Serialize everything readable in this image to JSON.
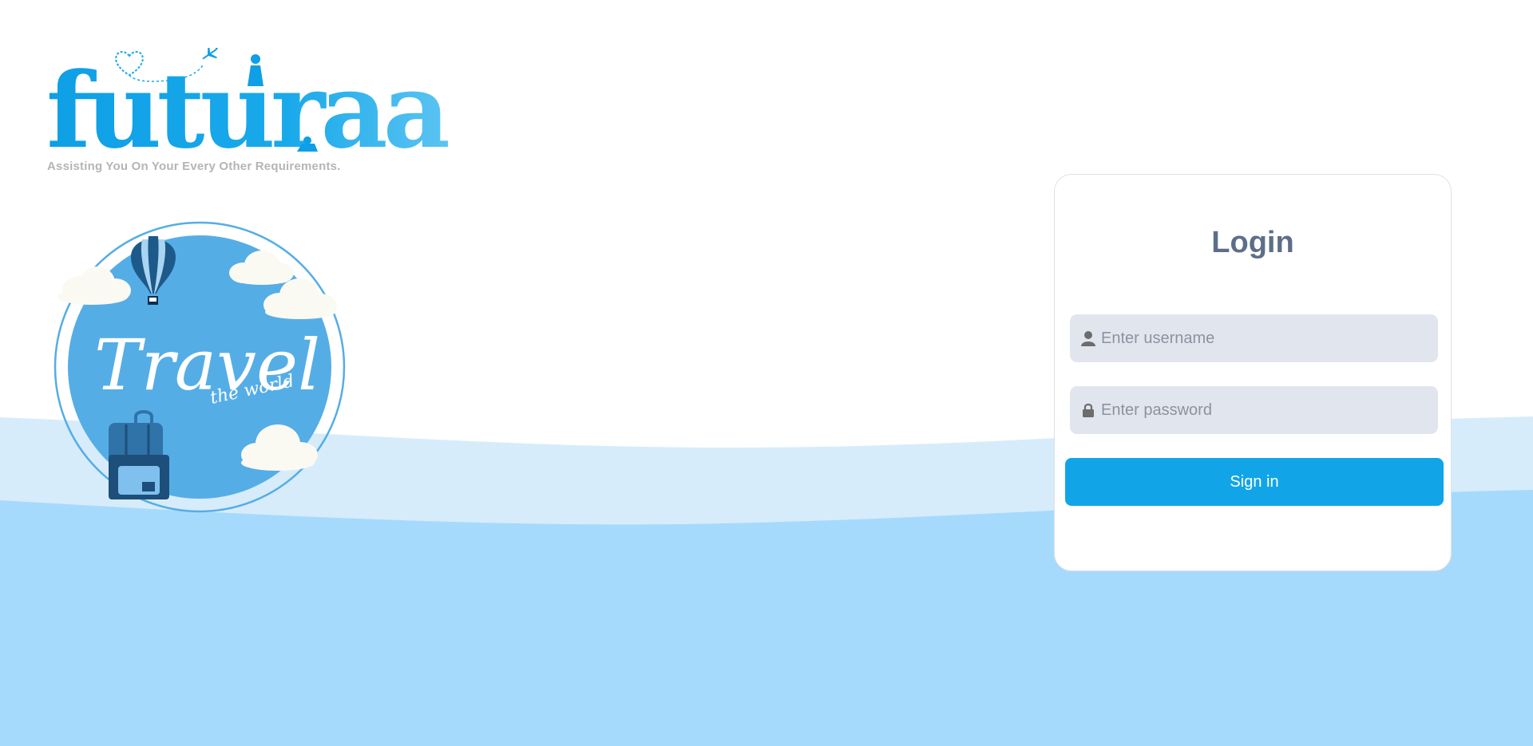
{
  "brand": {
    "logo_text": "futuraa",
    "tagline": "Assisting You On Your Every Other Requirements."
  },
  "badge": {
    "script_title": "Travel",
    "script_subtitle": "the world"
  },
  "login": {
    "title": "Login",
    "username_placeholder": "Enter username",
    "password_placeholder": "Enter password",
    "signin_label": "Sign in"
  },
  "icons": {
    "username": "user-icon",
    "password": "lock-icon",
    "balloon": "hot-air-balloon-icon",
    "backpack": "backpack-icon",
    "airplane": "airplane-icon",
    "heart": "heart-icon"
  },
  "colors": {
    "brand_blue": "#11a5e8",
    "wave_light": "#d6ecfb",
    "wave_main": "#a6dafd",
    "badge_fill": "#55ade6",
    "title_color": "#5d6e88",
    "input_bg": "#e1e6ee"
  }
}
